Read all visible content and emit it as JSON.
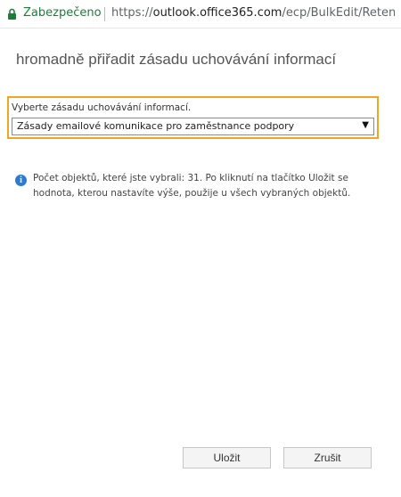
{
  "browser": {
    "security_label": "Zabezpečeno",
    "url_scheme": "https://",
    "url_host": "outlook.office365.com",
    "url_path": "/ecp/BulkEdit/Reten..."
  },
  "dialog": {
    "title": "hromadně přiřadit zásadu uchovávání informací",
    "policy_label": "Vyberte zásadu uchovávání informací.",
    "policy_selected": "Zásady emailové komunikace pro zaměstnance podpory",
    "info_icon": "info-icon",
    "info_text": "Počet objektů, které jste vybrali: 31.  Po kliknutí na tlačítko Uložit se hodnota, kterou nastavíte výše, použije u všech vybraných objektů.",
    "save_label": "Uložit",
    "cancel_label": "Zrušit"
  },
  "colors": {
    "secure_green": "#188038",
    "highlight_orange": "#f0a623",
    "info_blue": "#2a7ad6"
  }
}
